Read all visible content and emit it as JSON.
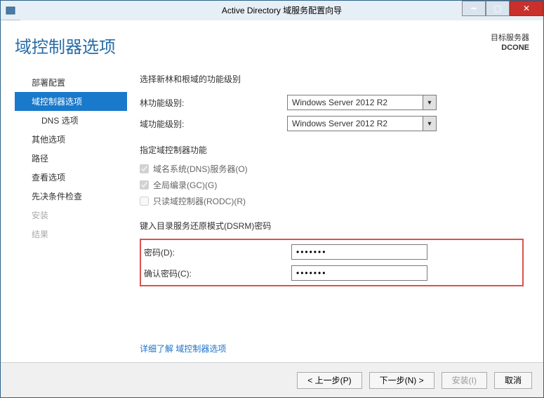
{
  "window": {
    "title": "Active Directory 域服务配置向导"
  },
  "header": {
    "page_title": "域控制器选项",
    "target_label": "目标服务器",
    "target_server": "DCONE"
  },
  "sidebar": {
    "items": [
      {
        "label": "部署配置"
      },
      {
        "label": "域控制器选项"
      },
      {
        "label": "DNS 选项"
      },
      {
        "label": "其他选项"
      },
      {
        "label": "路径"
      },
      {
        "label": "查看选项"
      },
      {
        "label": "先决条件检查"
      },
      {
        "label": "安装"
      },
      {
        "label": "结果"
      }
    ]
  },
  "form": {
    "section1_label": "选择新林和根域的功能级别",
    "forest_level_label": "林功能级别:",
    "forest_level_value": "Windows Server 2012 R2",
    "domain_level_label": "域功能级别:",
    "domain_level_value": "Windows Server 2012 R2",
    "section2_label": "指定域控制器功能",
    "cb_dns": "域名系统(DNS)服务器(O)",
    "cb_gc": "全局编录(GC)(G)",
    "cb_rodc": "只读域控制器(RODC)(R)",
    "section3_label": "键入目录服务还原模式(DSRM)密码",
    "pwd_label": "密码(D):",
    "pwd_value": "•••••••",
    "pwd_confirm_label": "确认密码(C):",
    "pwd_confirm_value": "•••••••",
    "more_link": "详细了解 域控制器选项"
  },
  "footer": {
    "prev": "< 上一步(P)",
    "next": "下一步(N) >",
    "install": "安装(I)",
    "cancel": "取消"
  }
}
